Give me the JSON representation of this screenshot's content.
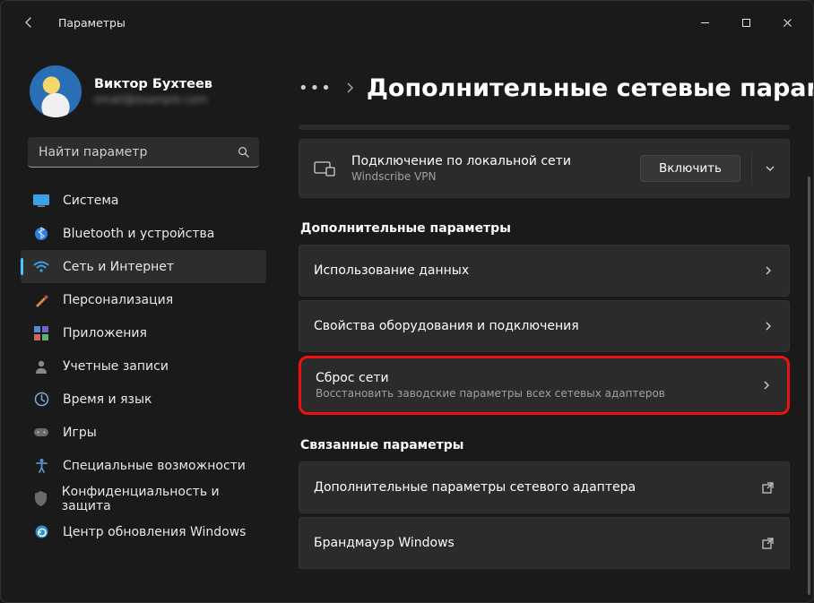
{
  "window": {
    "title": "Параметры"
  },
  "profile": {
    "name": "Виктор Бухтеев",
    "email": "email@example.com"
  },
  "search": {
    "placeholder": "Найти параметр"
  },
  "sidebar": {
    "items": [
      {
        "label": "Система",
        "icon": "🖥️"
      },
      {
        "label": "Bluetooth и устройства",
        "icon": "bt"
      },
      {
        "label": "Сеть и Интернет",
        "icon": "wifi",
        "active": true
      },
      {
        "label": "Персонализация",
        "icon": "brush"
      },
      {
        "label": "Приложения",
        "icon": "apps"
      },
      {
        "label": "Учетные записи",
        "icon": "user"
      },
      {
        "label": "Время и язык",
        "icon": "clock"
      },
      {
        "label": "Игры",
        "icon": "game"
      },
      {
        "label": "Специальные возможности",
        "icon": "acc"
      },
      {
        "label": "Конфиденциальность и защита",
        "icon": "shield"
      },
      {
        "label": "Центр обновления Windows",
        "icon": "update"
      }
    ]
  },
  "breadcrumb": {
    "ellipsis": "…",
    "page_title": "Дополнительные сетевые параметр"
  },
  "connection": {
    "title": "Подключение по локальной сети",
    "subtitle": "Windscribe VPN",
    "button": "Включить"
  },
  "sections": {
    "more": "Дополнительные параметры",
    "related": "Связанные параметры"
  },
  "items": {
    "data_usage": "Использование данных",
    "hw_props": "Свойства оборудования и подключения",
    "reset_title": "Сброс сети",
    "reset_sub": "Восстановить заводские параметры всех сетевых адаптеров",
    "adapter_opts": "Дополнительные параметры сетевого адаптера",
    "firewall": "Брандмауэр Windows"
  }
}
